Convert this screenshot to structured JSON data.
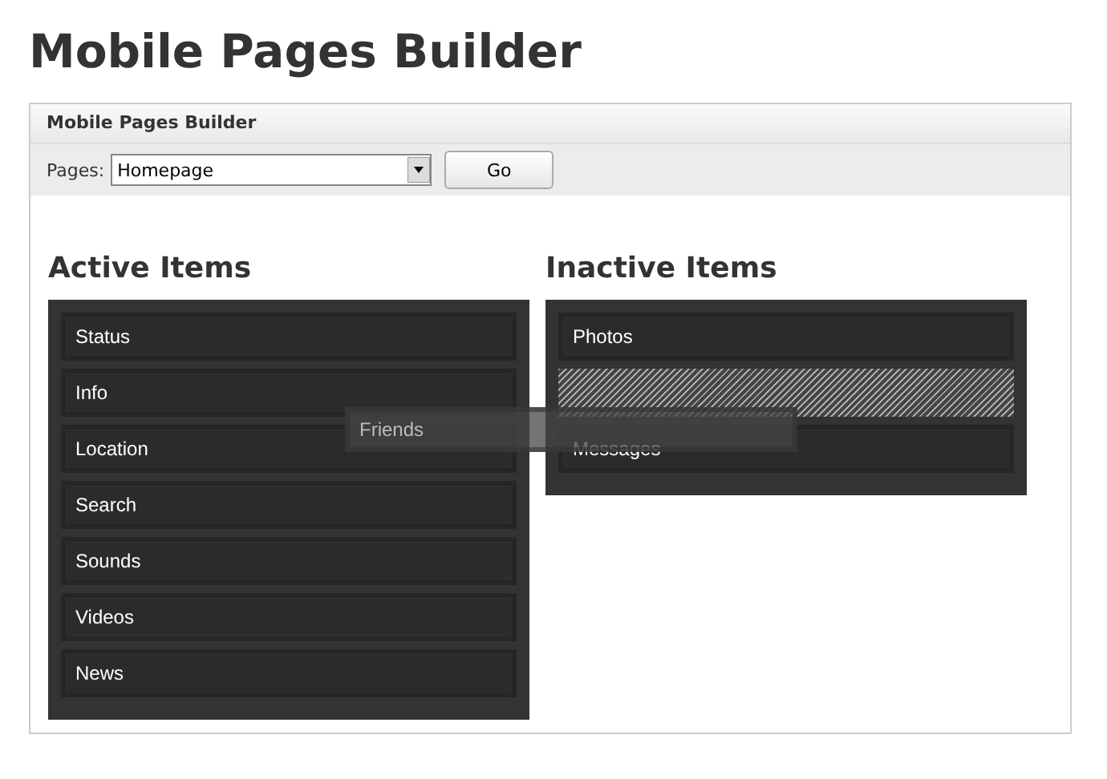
{
  "page_title": "Mobile Pages Builder",
  "panel": {
    "title": "Mobile Pages Builder",
    "toolbar": {
      "label": "Pages:",
      "select_value": "Homepage",
      "button": "Go"
    },
    "columns": [
      {
        "heading": "Active Items",
        "items": [
          {
            "kind": "item",
            "label": "Status"
          },
          {
            "kind": "item",
            "label": "Info"
          },
          {
            "kind": "item",
            "label": "Location"
          },
          {
            "kind": "item",
            "label": "Search"
          },
          {
            "kind": "item",
            "label": "Sounds"
          },
          {
            "kind": "item",
            "label": "Videos"
          },
          {
            "kind": "item",
            "label": "News"
          }
        ]
      },
      {
        "heading": "Inactive Items",
        "items": [
          {
            "kind": "item",
            "label": "Photos"
          },
          {
            "kind": "placeholder"
          },
          {
            "kind": "item",
            "label": "Messages"
          }
        ]
      }
    ],
    "dragged_item": {
      "label": "Friends"
    }
  }
}
